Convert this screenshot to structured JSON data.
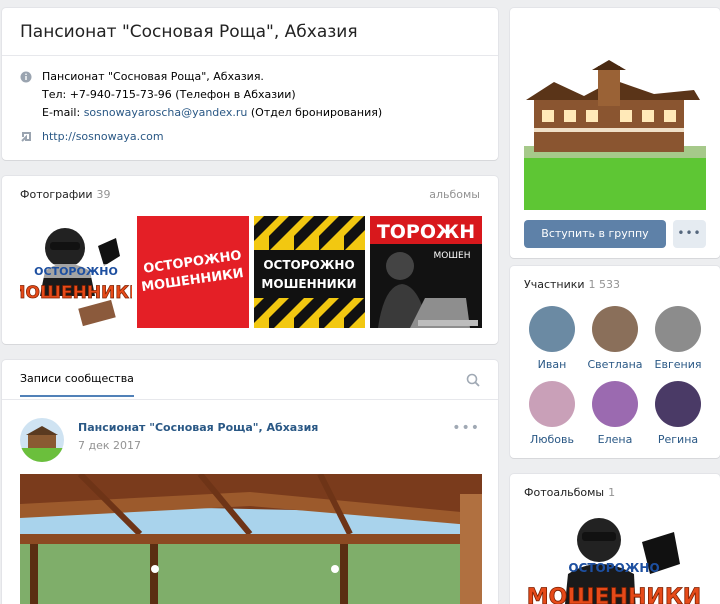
{
  "group": {
    "title": "Пансионат \"Сосновая Роща\", Абхазия",
    "info_line1": "Пансионат \"Сосновая Роща\", Абхазия.",
    "info_line2": "Тел: +7-940-715-73-96 (Телефон в Абхазии)",
    "info_email_prefix": "E-mail: ",
    "info_email": "sosnowayaroscha@yandex.ru",
    "info_email_suffix": " (Отдел бронирования)",
    "website": "http://sosnowaya.com"
  },
  "photos": {
    "heading": "Фотографии",
    "count": "39",
    "albums_link": "альбомы",
    "items": [
      {
        "text_top": "ОСТОРОЖНО",
        "text_bottom": "МОШЕННИКИ"
      },
      {
        "text_top": "ОСТОРОЖНО",
        "text_bottom": "МОШЕННИКИ"
      },
      {
        "text_top": "ОСТОРОЖНО",
        "text_bottom": "МОШЕННИКИ"
      },
      {
        "text_top": "ТОРОЖН",
        "text_bottom": "МОШЕН"
      }
    ]
  },
  "wall": {
    "tab": "Записи сообщества",
    "post_author": "Пансионат \"Сосновая Роща\", Абхазия",
    "post_date": "7 дек 2017",
    "more": "•••"
  },
  "sidebar": {
    "join_button": "Вступить в группу",
    "more_button": "•••",
    "members_heading": "Участники",
    "members_count": "1 533",
    "members": [
      {
        "name": "Иван",
        "color": "#6b8aa3"
      },
      {
        "name": "Светлана",
        "color": "#8a6f5a"
      },
      {
        "name": "Евгения",
        "color": "#8c8c8c"
      },
      {
        "name": "Любовь",
        "color": "#c9a0b8"
      },
      {
        "name": "Елена",
        "color": "#9b6ab0"
      },
      {
        "name": "Регина",
        "color": "#4a3a66"
      }
    ],
    "albums_heading": "Фотоальбомы",
    "albums_count": "1",
    "album_text_top": "ОСТОРОЖНО",
    "album_text_bottom": "МОШЕННИКИ"
  },
  "colors": {
    "link": "#2a5885",
    "button": "#5e81a8",
    "background": "#edeef0"
  }
}
